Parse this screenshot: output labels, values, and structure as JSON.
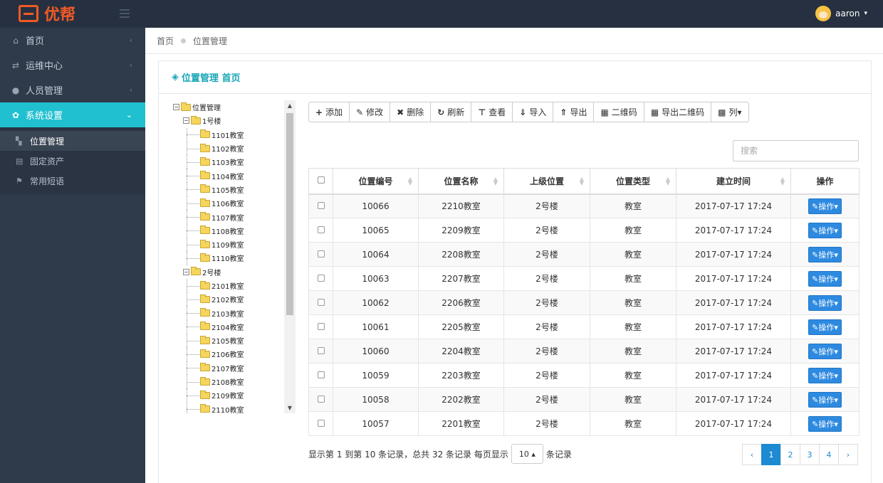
{
  "app": {
    "name": "优帮",
    "user": "aaron"
  },
  "sidebar": {
    "items": [
      {
        "label": "首页",
        "icon": "home-icon"
      },
      {
        "label": "运维中心",
        "icon": "shuffle-icon"
      },
      {
        "label": "人员管理",
        "icon": "user-icon"
      },
      {
        "label": "系统设置",
        "icon": "gear-icon"
      }
    ],
    "submenu": [
      {
        "label": "位置管理",
        "icon": "sitemap-icon"
      },
      {
        "label": "固定资产",
        "icon": "printer-icon"
      },
      {
        "label": "常用短语",
        "icon": "flag-icon"
      }
    ]
  },
  "breadcrumb": {
    "home": "首页",
    "current": "位置管理"
  },
  "panel": {
    "title": "位置管理 首页"
  },
  "tree": {
    "root": "位置管理",
    "buildings": [
      {
        "label": "1号楼",
        "rooms": [
          "1101教室",
          "1102教室",
          "1103教室",
          "1104教室",
          "1105教室",
          "1106教室",
          "1107教室",
          "1108教室",
          "1109教室",
          "1110教室"
        ]
      },
      {
        "label": "2号楼",
        "rooms": [
          "2101教室",
          "2102教室",
          "2103教室",
          "2104教室",
          "2105教室",
          "2106教室",
          "2107教室",
          "2108教室",
          "2109教室",
          "2110教室"
        ]
      }
    ]
  },
  "toolbar": {
    "add": "添加",
    "edit": "修改",
    "delete": "删除",
    "refresh": "刷新",
    "view": "查看",
    "import": "导入",
    "export": "导出",
    "qrcode": "二维码",
    "export_qrcode": "导出二维码",
    "columns": "列"
  },
  "search": {
    "placeholder": "搜索"
  },
  "table": {
    "headers": [
      "位置编号",
      "位置名称",
      "上级位置",
      "位置类型",
      "建立时间",
      "操作"
    ],
    "action_label": "操作",
    "rows": [
      [
        "10066",
        "2210教室",
        "2号楼",
        "教室",
        "2017-07-17 17:24"
      ],
      [
        "10065",
        "2209教室",
        "2号楼",
        "教室",
        "2017-07-17 17:24"
      ],
      [
        "10064",
        "2208教室",
        "2号楼",
        "教室",
        "2017-07-17 17:24"
      ],
      [
        "10063",
        "2207教室",
        "2号楼",
        "教室",
        "2017-07-17 17:24"
      ],
      [
        "10062",
        "2206教室",
        "2号楼",
        "教室",
        "2017-07-17 17:24"
      ],
      [
        "10061",
        "2205教室",
        "2号楼",
        "教室",
        "2017-07-17 17:24"
      ],
      [
        "10060",
        "2204教室",
        "2号楼",
        "教室",
        "2017-07-17 17:24"
      ],
      [
        "10059",
        "2203教室",
        "2号楼",
        "教室",
        "2017-07-17 17:24"
      ],
      [
        "10058",
        "2202教室",
        "2号楼",
        "教室",
        "2017-07-17 17:24"
      ],
      [
        "10057",
        "2201教室",
        "2号楼",
        "教室",
        "2017-07-17 17:24"
      ]
    ]
  },
  "footer": {
    "summary": "显示第 1 到第 10 条记录，总共 32 条记录 每页显示",
    "page_size": "10",
    "suffix": "条记录"
  },
  "pager": {
    "prev": "‹",
    "pages": [
      "1",
      "2",
      "3",
      "4"
    ],
    "next": "›",
    "current": "1"
  }
}
